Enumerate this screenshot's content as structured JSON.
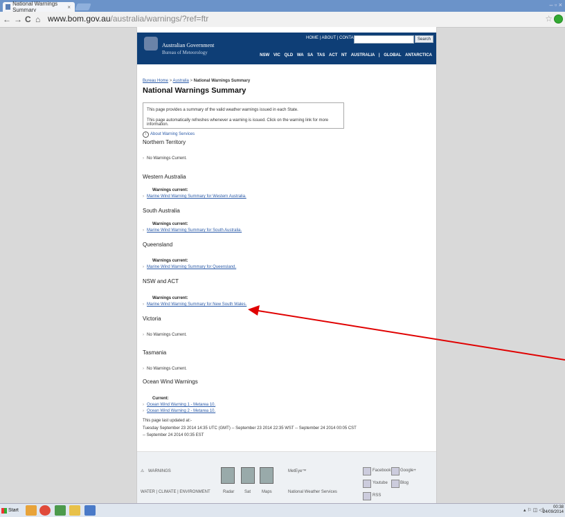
{
  "browser": {
    "tab_title": "National Warnings Summary",
    "tab_close": "×",
    "win_controls": "– ▫ ×",
    "back": "←",
    "forward": "→",
    "reload": "C",
    "home": "⌂",
    "url_host": "www.bom.gov.au",
    "url_path": "/australia/warnings/?ref=ftr",
    "star": "☆"
  },
  "header": {
    "gov_line1": "Australian Government",
    "gov_line2": "Bureau of Meteorology",
    "toplinks": "HOME | ABOUT | CONTACTS",
    "search_label": "Search",
    "state_nav": [
      "NSW",
      "VIC",
      "QLD",
      "WA",
      "SA",
      "TAS",
      "ACT",
      "NT",
      "AUSTRALIA",
      "|",
      "GLOBAL",
      "ANTARCTICA"
    ]
  },
  "breadcrumb": {
    "home": "Bureau Home",
    "sep1": " > ",
    "australia": "Australia",
    "sep2": " > ",
    "current": "National Warnings Summary"
  },
  "page": {
    "title": "National Warnings Summary",
    "info1": "This page provides a summary of the valid weather warnings issued in each State.",
    "info2": "This page automatically refreshes whenever a warning is issued. Click on the warning link for more information.",
    "about_icon": "i",
    "about": "About Warning Services"
  },
  "sections": {
    "nt": {
      "heading": "Northern Territory",
      "status": "No Warnings Current."
    },
    "wa": {
      "heading": "Western Australia",
      "current": "Warnings current:",
      "link": "Marine Wind Warning Summary for Western Australia."
    },
    "sa": {
      "heading": "South Australia",
      "current": "Warnings current:",
      "link": "Marine Wind Warning Summary for South Australia."
    },
    "qld": {
      "heading": "Queensland",
      "current": "Warnings current:",
      "link": "Marine Wind Warning Summary for Queensland."
    },
    "nsw": {
      "heading": "NSW and ACT",
      "current": "Warnings current:",
      "link": "Marine Wind Warning Summary for New South Wales."
    },
    "vic": {
      "heading": "Victoria",
      "status": "No Warnings Current."
    },
    "tas": {
      "heading": "Tasmania",
      "status": "No Warnings Current."
    },
    "ocean": {
      "heading": "Ocean Wind Warnings",
      "current": "Current:",
      "link1": "Ocean Wind Warning 1 - Metarea 10.",
      "link2": "Ocean Wind Warning 2 - Metarea 10."
    }
  },
  "updated": {
    "line1": "This page last updated at:-",
    "line2": "Tuesday September 23 2014 14:35 UTC (GMT) -- September 23 2014 22:35 WST -- September 24 2014 00:05 CST",
    "line3": "-- September 24 2014 00:35 EST"
  },
  "footer": {
    "warnings": "WARNINGS",
    "links": "WATER | CLIMATE | ENVIRONMENT",
    "radar": "Radar",
    "sat": "Sat",
    "maps": "Maps",
    "meteye": "MetEye™",
    "nws": "National Weather Services",
    "facebook": "Facebook",
    "googleplus": "Google+",
    "youtube": "Youtube",
    "blog": "Blog",
    "rss": "RSS"
  },
  "taskbar": {
    "start": "Start",
    "clock_time": "00:38",
    "clock_date": "24/09/2014"
  },
  "colors": {
    "header_bg": "#0e3e76",
    "link": "#2a5aa8",
    "arrow": "#e00000"
  }
}
